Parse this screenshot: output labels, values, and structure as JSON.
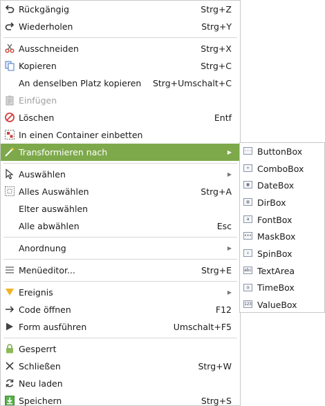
{
  "menu": {
    "items": [
      {
        "key": "undo",
        "label": "Rückgängig",
        "shortcut": "Strg+Z",
        "icon": "undo-icon"
      },
      {
        "key": "redo",
        "label": "Wiederholen",
        "shortcut": "Strg+Y",
        "icon": "redo-icon"
      },
      {
        "sep": true
      },
      {
        "key": "cut",
        "label": "Ausschneiden",
        "shortcut": "Strg+X",
        "icon": "scissors-icon"
      },
      {
        "key": "copy",
        "label": "Kopieren",
        "shortcut": "Strg+C",
        "icon": "copy-icon"
      },
      {
        "key": "copy-same-place",
        "label": "An denselben Platz kopieren",
        "shortcut": "Strg+Umschalt+C",
        "icon": ""
      },
      {
        "key": "paste",
        "label": "Einfügen",
        "shortcut": "",
        "icon": "clipboard-icon",
        "disabled": true
      },
      {
        "key": "delete",
        "label": "Löschen",
        "shortcut": "Entf",
        "icon": "delete-icon"
      },
      {
        "key": "embed",
        "label": "In einen Container einbetten",
        "shortcut": "",
        "icon": "container-icon"
      },
      {
        "key": "transform",
        "label": "Transformieren nach",
        "shortcut": "",
        "icon": "wand-icon",
        "submenu": true,
        "highlight": true
      },
      {
        "sep": true
      },
      {
        "key": "select",
        "label": "Auswählen",
        "shortcut": "",
        "icon": "cursor-icon",
        "submenu": true
      },
      {
        "key": "select-all",
        "label": "Alles Auswählen",
        "shortcut": "Strg+A",
        "icon": "select-all-icon"
      },
      {
        "key": "select-parent",
        "label": "Elter auswählen",
        "shortcut": "",
        "icon": ""
      },
      {
        "key": "deselect-all",
        "label": "Alle abwählen",
        "shortcut": "Esc",
        "icon": ""
      },
      {
        "sep": true
      },
      {
        "key": "arrange",
        "label": "Anordnung",
        "shortcut": "",
        "icon": "",
        "submenu": true
      },
      {
        "sep": true
      },
      {
        "key": "menu-editor",
        "label": "Menüeditor...",
        "shortcut": "Strg+E",
        "icon": "menu-icon"
      },
      {
        "sep": true
      },
      {
        "key": "event",
        "label": "Ereignis",
        "shortcut": "",
        "icon": "event-icon",
        "submenu": true
      },
      {
        "key": "open-code",
        "label": "Code öffnen",
        "shortcut": "F12",
        "icon": "arrow-right-icon"
      },
      {
        "key": "run-form",
        "label": "Form ausführen",
        "shortcut": "Umschalt+F5",
        "icon": "play-icon"
      },
      {
        "sep": true
      },
      {
        "key": "locked",
        "label": "Gesperrt",
        "shortcut": "",
        "icon": "lock-icon"
      },
      {
        "key": "close",
        "label": "Schließen",
        "shortcut": "Strg+W",
        "icon": "close-icon"
      },
      {
        "key": "reload",
        "label": "Neu laden",
        "shortcut": "",
        "icon": "reload-icon"
      },
      {
        "key": "save",
        "label": "Speichern",
        "shortcut": "Strg+S",
        "icon": "save-icon"
      }
    ]
  },
  "submenu": {
    "items": [
      {
        "label": "ButtonBox",
        "icon": "buttonbox-icon",
        "glyph": "···"
      },
      {
        "label": "ComboBox",
        "icon": "combobox-icon",
        "glyph": "▾"
      },
      {
        "label": "DateBox",
        "icon": "datebox-icon",
        "glyph": "▦"
      },
      {
        "label": "DirBox",
        "icon": "dirbox-icon",
        "glyph": "▤"
      },
      {
        "label": "FontBox",
        "icon": "fontbox-icon",
        "glyph": "a"
      },
      {
        "label": "MaskBox",
        "icon": "maskbox-icon",
        "glyph": "•••"
      },
      {
        "label": "SpinBox",
        "icon": "spinbox-icon",
        "glyph": "⇕"
      },
      {
        "label": "TextArea",
        "icon": "textarea-icon",
        "glyph": "abc"
      },
      {
        "label": "TimeBox",
        "icon": "timebox-icon",
        "glyph": "◷"
      },
      {
        "label": "ValueBox",
        "icon": "valuebox-icon",
        "glyph": "123"
      }
    ]
  },
  "colors": {
    "highlight": "#7ea94b",
    "separator": "#d6d6d6",
    "border": "#c8c8c8"
  }
}
